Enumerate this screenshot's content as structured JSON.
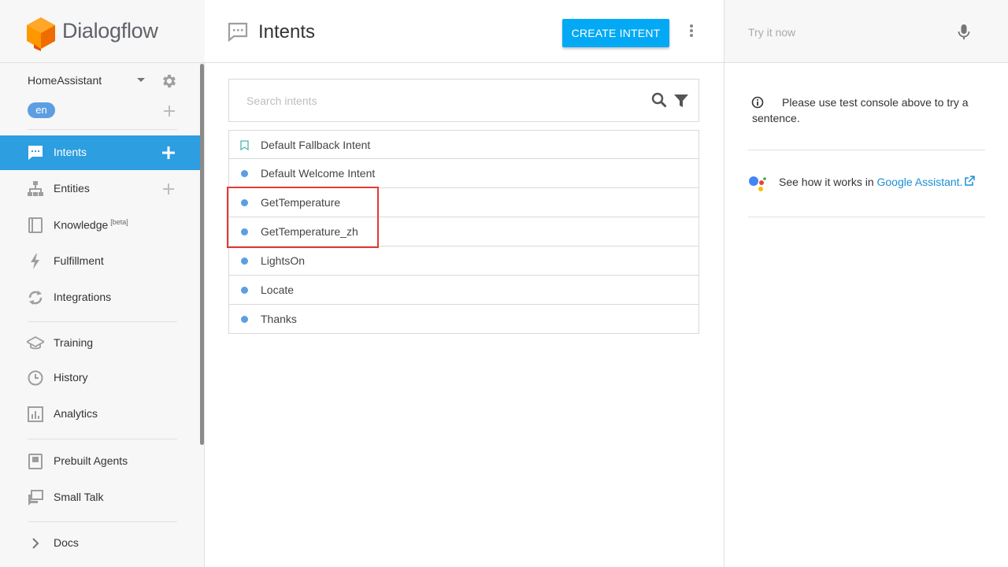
{
  "brand": {
    "name": "Dialogflow"
  },
  "agent": {
    "name": "HomeAssistant",
    "language": "en"
  },
  "nav": {
    "intents": "Intents",
    "entities": "Entities",
    "knowledge": "Knowledge",
    "knowledge_badge": "[beta]",
    "fulfillment": "Fulfillment",
    "integrations": "Integrations",
    "training": "Training",
    "history": "History",
    "analytics": "Analytics",
    "prebuilt_agents": "Prebuilt Agents",
    "small_talk": "Small Talk",
    "docs": "Docs"
  },
  "header": {
    "title": "Intents",
    "create_button": "CREATE INTENT"
  },
  "search": {
    "placeholder": "Search intents"
  },
  "intents": [
    "Default Fallback Intent",
    "Default Welcome Intent",
    "GetTemperature",
    "GetTemperature_zh",
    "LightsOn",
    "Locate",
    "Thanks"
  ],
  "console": {
    "placeholder": "Try it now",
    "info": "Please use test console above to try a sentence.",
    "assistant_prefix": "See how it works in",
    "assistant_link": "Google Assistant."
  },
  "colors": {
    "accent": "#03a9f4",
    "active_nav": "#2d9ee0",
    "highlight": "#e53935",
    "logo": "#f57c00"
  }
}
